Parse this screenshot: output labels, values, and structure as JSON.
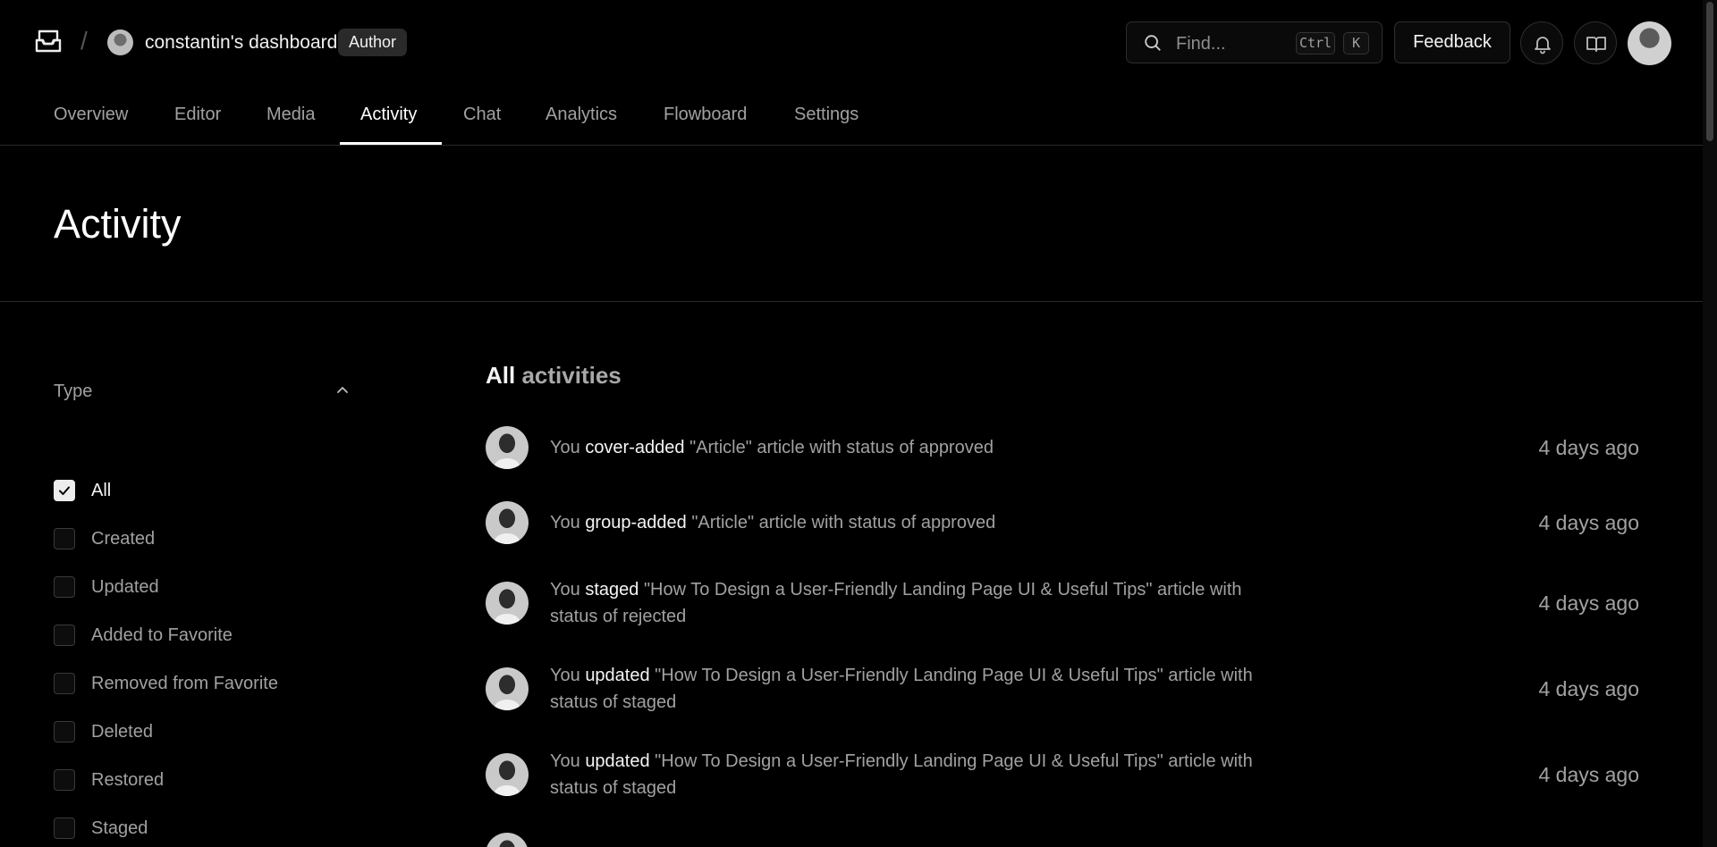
{
  "header": {
    "team_name": "constantin's dashboard",
    "role_badge": "Author",
    "search_placeholder": "Find...",
    "shortcut_keys": [
      "Ctrl",
      "K"
    ],
    "feedback_label": "Feedback"
  },
  "tabs": [
    {
      "label": "Overview",
      "active": false
    },
    {
      "label": "Editor",
      "active": false
    },
    {
      "label": "Media",
      "active": false
    },
    {
      "label": "Activity",
      "active": true
    },
    {
      "label": "Chat",
      "active": false
    },
    {
      "label": "Analytics",
      "active": false
    },
    {
      "label": "Flowboard",
      "active": false
    },
    {
      "label": "Settings",
      "active": false
    }
  ],
  "page_title": "Activity",
  "filters": {
    "header": "Type",
    "items": [
      {
        "label": "All",
        "checked": true
      },
      {
        "label": "Created",
        "checked": false
      },
      {
        "label": "Updated",
        "checked": false
      },
      {
        "label": "Added to Favorite",
        "checked": false
      },
      {
        "label": "Removed from Favorite",
        "checked": false
      },
      {
        "label": "Deleted",
        "checked": false
      },
      {
        "label": "Restored",
        "checked": false
      },
      {
        "label": "Staged",
        "checked": false
      }
    ]
  },
  "feed": {
    "title_part1": "All",
    "title_part2": "activities",
    "items": [
      {
        "actor": "You",
        "verb": "cover-added",
        "text": "\"Article\" article with status of approved",
        "time": "4 days ago"
      },
      {
        "actor": "You",
        "verb": "group-added",
        "text": "\"Article\" article with status of approved",
        "time": "4 days ago"
      },
      {
        "actor": "You",
        "verb": "staged",
        "text": "\"How To Design a User-Friendly Landing Page UI & Useful Tips\" article with status of rejected",
        "time": "4 days ago"
      },
      {
        "actor": "You",
        "verb": "updated",
        "text": "\"How To Design a User-Friendly Landing Page UI & Useful Tips\" article with status of staged",
        "time": "4 days ago"
      },
      {
        "actor": "You",
        "verb": "updated",
        "text": "\"How To Design a User-Friendly Landing Page UI & Useful Tips\" article with status of staged",
        "time": "4 days ago"
      }
    ]
  }
}
